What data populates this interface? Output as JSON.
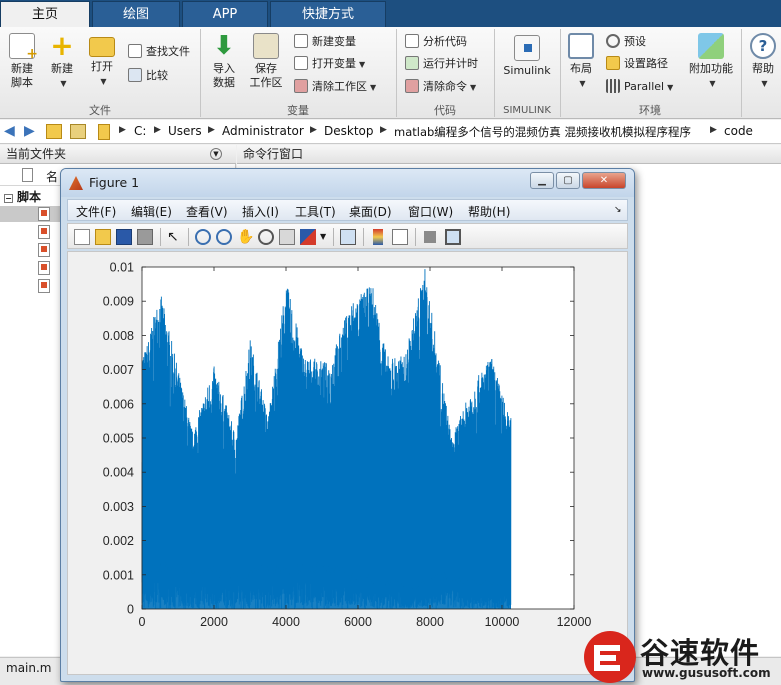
{
  "tabs": [
    {
      "label": "主页",
      "active": true
    },
    {
      "label": "绘图",
      "active": false
    },
    {
      "label": "APP",
      "active": false
    },
    {
      "label": "快捷方式",
      "active": false
    }
  ],
  "ribbon": {
    "file_group": {
      "label": "文件",
      "new_script": "新建\n脚本",
      "new": "新建",
      "open": "打开",
      "find_files": "查找文件",
      "compare": "比较"
    },
    "variable_group": {
      "label": "变量",
      "import_data": "导入\n数据",
      "save_workspace": "保存\n工作区",
      "new_variable": "新建变量",
      "open_variable": "打开变量",
      "clear_workspace": "清除工作区"
    },
    "code_group": {
      "label": "代码",
      "analyze_code": "分析代码",
      "run_and_time": "运行并计时",
      "clear_commands": "清除命令"
    },
    "simulink_group": {
      "label": "SIMULINK",
      "simulink": "Simulink"
    },
    "environment_group": {
      "label": "环境",
      "layout": "布局",
      "preferences": "预设",
      "set_path": "设置路径",
      "parallel": "Parallel",
      "addons": "附加功能"
    },
    "help": "帮助"
  },
  "address": {
    "path": [
      "C:",
      "Users",
      "Administrator",
      "Desktop",
      "matlab编程多个信号的混频仿真 混频接收机模拟程序程序",
      "code"
    ]
  },
  "panels": {
    "current_folder": "当前文件夹",
    "command_window": "命令行窗口",
    "name_col": "名",
    "tree_root": "脚本",
    "status_file": "main.m"
  },
  "figure": {
    "title": "Figure 1",
    "menus": [
      "文件(F)",
      "编辑(E)",
      "查看(V)",
      "插入(I)",
      "工具(T)",
      "桌面(D)",
      "窗口(W)",
      "帮助(H)"
    ]
  },
  "chart_data": {
    "type": "line",
    "title": "",
    "xlabel": "",
    "ylabel": "",
    "xlim": [
      0,
      12000
    ],
    "ylim": [
      0,
      0.01
    ],
    "xticks": [
      "0",
      "2000",
      "4000",
      "6000",
      "8000",
      "10000",
      "12000"
    ],
    "yticks": [
      "0",
      "0.001",
      "0.002",
      "0.003",
      "0.004",
      "0.005",
      "0.006",
      "0.007",
      "0.008",
      "0.009",
      "0.01"
    ],
    "x_range_of_data": [
      0,
      10250
    ],
    "envelope_peaks": [
      {
        "x": 100,
        "y": 0.0076
      },
      {
        "x": 500,
        "y": 0.0093
      },
      {
        "x": 1400,
        "y": 0.0052
      },
      {
        "x": 2000,
        "y": 0.0071
      },
      {
        "x": 2600,
        "y": 0.0051
      },
      {
        "x": 3000,
        "y": 0.0079
      },
      {
        "x": 3500,
        "y": 0.0056
      },
      {
        "x": 4000,
        "y": 0.0096
      },
      {
        "x": 4500,
        "y": 0.0074
      },
      {
        "x": 5200,
        "y": 0.0072
      },
      {
        "x": 5800,
        "y": 0.009
      },
      {
        "x": 6400,
        "y": 0.0095
      },
      {
        "x": 6800,
        "y": 0.0074
      },
      {
        "x": 7300,
        "y": 0.0074
      },
      {
        "x": 7850,
        "y": 0.01
      },
      {
        "x": 8600,
        "y": 0.005
      },
      {
        "x": 9200,
        "y": 0.0066
      },
      {
        "x": 9700,
        "y": 0.0074
      },
      {
        "x": 10200,
        "y": 0.0056
      }
    ],
    "envelope_troughs": [
      {
        "x": 1000,
        "y": 0.0014
      },
      {
        "x": 2700,
        "y": 0.0012
      },
      {
        "x": 4600,
        "y": 0.0015
      },
      {
        "x": 6400,
        "y": 0.001
      },
      {
        "x": 7600,
        "y": 0.0008
      },
      {
        "x": 8400,
        "y": 0.0012
      },
      {
        "x": 8900,
        "y": 0.0009
      }
    ],
    "color": "#0072bd"
  },
  "watermark": {
    "brand": "谷速软件",
    "url": "www.gususoft.com"
  }
}
